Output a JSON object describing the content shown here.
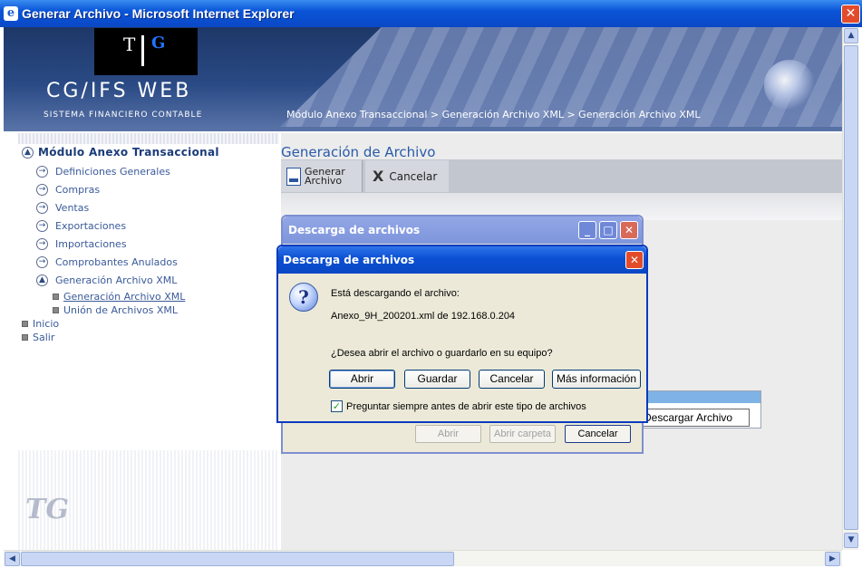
{
  "window": {
    "title": "Generar Archivo - Microsoft Internet Explorer",
    "close": "✕"
  },
  "banner": {
    "app_name": "CG/IFS WEB",
    "subtitle": "SISTEMA FINANCIERO CONTABLE",
    "breadcrumb": "Módulo Anexo Transaccional > Generación Archivo XML > Generación Archivo XML",
    "logo_left": "T",
    "logo_right": "G"
  },
  "sidebar": {
    "header": "Módulo Anexo Transaccional",
    "items": [
      "Definiciones Generales",
      "Compras",
      "Ventas",
      "Exportaciones",
      "Importaciones",
      "Comprobantes Anulados",
      "Generación Archivo XML"
    ],
    "subitems": [
      "Generación Archivo XML",
      "Unión de Archivos XML"
    ],
    "root_items": [
      "Inicio",
      "Salir"
    ],
    "watermark": "TG"
  },
  "main": {
    "page_title": "Generación de Archivo",
    "toolbar": {
      "generate_line1": "Generar",
      "generate_line2": "Archivo",
      "cancel": "Cancelar"
    },
    "behind_button": "Descargar Archivo"
  },
  "dialog_back": {
    "title": "Descarga de archivos",
    "buttons": [
      "Abrir",
      "Abrir carpeta",
      "Cancelar"
    ]
  },
  "dialog": {
    "title": "Descarga de archivos",
    "line1": "Está descargando el archivo:",
    "file": "Anexo_9H_200201.xml de 192.168.0.204",
    "question": "¿Desea abrir el archivo o guardarlo en su equipo?",
    "buttons": [
      "Abrir",
      "Guardar",
      "Cancelar",
      "Más información"
    ],
    "checkbox_label": "Preguntar siempre antes de abrir este tipo de archivos",
    "checkbox_checked": true
  }
}
